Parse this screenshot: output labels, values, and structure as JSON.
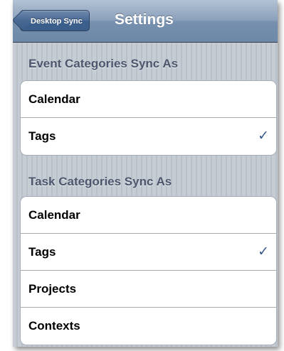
{
  "navbar": {
    "back_label": "Desktop Sync",
    "title": "Settings"
  },
  "sections": [
    {
      "header": "Event Categories Sync As",
      "options": [
        {
          "label": "Calendar",
          "checked": false
        },
        {
          "label": "Tags",
          "checked": true
        }
      ]
    },
    {
      "header": "Task Categories Sync As",
      "options": [
        {
          "label": "Calendar",
          "checked": false
        },
        {
          "label": "Tags",
          "checked": true
        },
        {
          "label": "Projects",
          "checked": false
        },
        {
          "label": "Contexts",
          "checked": false
        }
      ]
    }
  ],
  "icons": {
    "checkmark": "✓"
  },
  "colors": {
    "navbar": "#8aa0bb",
    "checkmark": "#3a5a8c",
    "section_header": "#4c566c",
    "background": "#c5ccd4"
  }
}
